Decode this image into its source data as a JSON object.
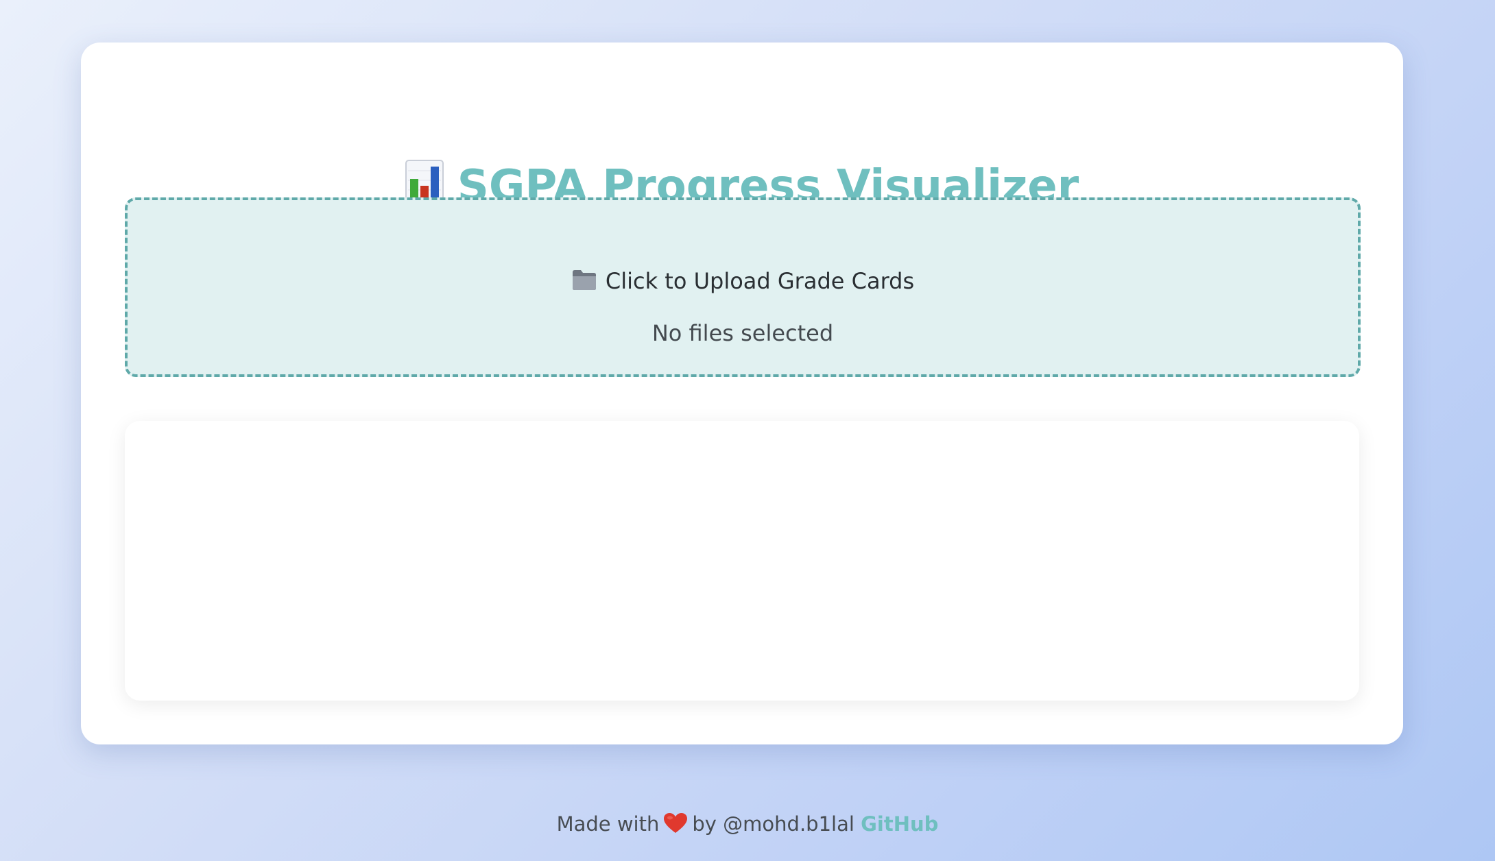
{
  "header": {
    "title_icon": "bar-chart-icon",
    "title": "SGPA Progress Visualizer",
    "title_color": "#6fbfbf"
  },
  "upload": {
    "icon": "folder-icon",
    "label": "Click to Upload Grade Cards",
    "status": "No files selected",
    "border_color": "#5fa9a9",
    "background_color": "#e1f1f1"
  },
  "chart_panel": {
    "content": ""
  },
  "footer": {
    "made_with": "Made with",
    "heart_icon": "heart-icon",
    "by": "by @mohd.b1lal",
    "link_label": "GitHub",
    "link_color": "#6fbfbf"
  }
}
